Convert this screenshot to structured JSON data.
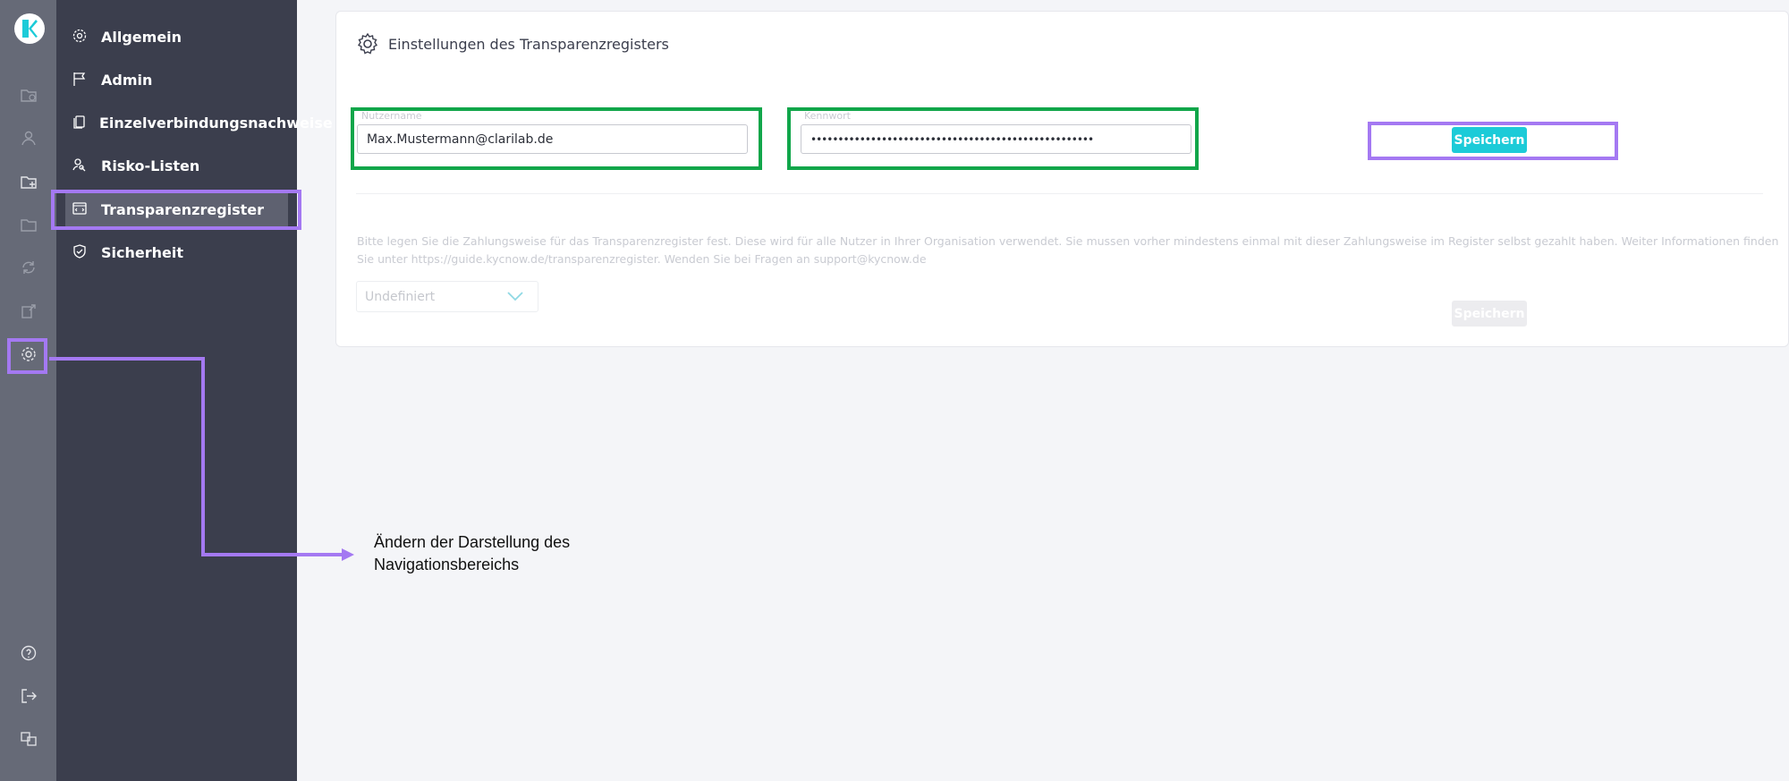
{
  "sidebar": {
    "items": [
      {
        "label": "Allgemein",
        "icon": "gear-icon"
      },
      {
        "label": "Admin",
        "icon": "flag-icon"
      },
      {
        "label": "Einzelverbindungsnachweise",
        "icon": "copy-icon"
      },
      {
        "label": "Risko-Listen",
        "icon": "user-search-icon"
      },
      {
        "label": "Transparenzregister",
        "icon": "register-icon",
        "active": true
      },
      {
        "label": "Sicherheit",
        "icon": "shield-icon"
      }
    ]
  },
  "rail": {
    "icons": [
      "folder-clock-icon",
      "user-icon",
      "folder-add-icon",
      "folder-icon",
      "refresh-icon",
      "export-icon",
      "settings-icon",
      "help-icon",
      "logout-icon",
      "language-icon"
    ]
  },
  "card": {
    "title": "Einstellungen des Transparenzregisters",
    "username_label": "Nutzername",
    "username_value": "Max.Mustermann@clarilab.de",
    "password_label": "Kennwort",
    "password_value": "••••••••••••••••••••••••••••••••••••••••••••••••••••",
    "save_label": "Speichern",
    "info_text": "Bitte legen Sie die Zahlungsweise für das Transparenzregister fest. Diese wird für alle Nutzer in Ihrer Organisation verwendet. Sie mussen vorher mindestens einmal mit dieser Zahlungsweise im Register selbst gezahlt haben. Weiter Informationen finden Sie unter https://guide.kycnow.de/transparenzregister. Wenden Sie bei Fragen an support@kycnow.de",
    "payment_select_value": "Undefiniert",
    "save_label_2": "Speichern"
  },
  "annotation": {
    "line1": "Ändern der Darstellung des",
    "line2": "Navigationsbereichs"
  },
  "colors": {
    "accent": "#1ccbd8",
    "highlight_purple": "#a479f2",
    "highlight_green": "#10a64a",
    "sidebar_bg": "#3b3e4d",
    "rail_bg": "#666a77"
  }
}
